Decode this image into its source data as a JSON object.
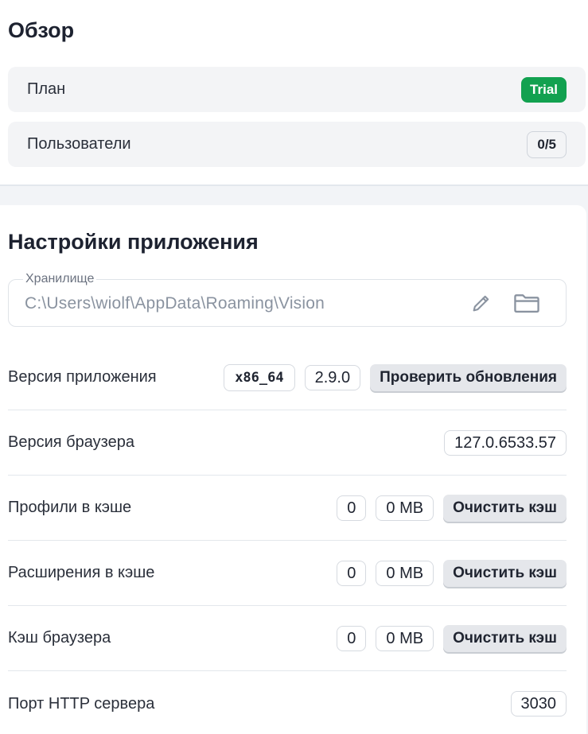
{
  "overview": {
    "title": "Обзор",
    "plan": {
      "label": "План",
      "badge": "Trial"
    },
    "users": {
      "label": "Пользователи",
      "badge": "0/5"
    }
  },
  "settings": {
    "title": "Настройки приложения",
    "storage": {
      "label": "Хранилище",
      "value": "C:\\Users\\wiolf\\AppData\\Roaming\\Vision",
      "icons": [
        "pencil-icon",
        "folder-icon"
      ]
    },
    "app_version": {
      "label": "Версия приложения",
      "arch": "x86_64",
      "version": "2.9.0",
      "button": "Проверить обновления"
    },
    "browser_version": {
      "label": "Версия браузера",
      "value": "127.0.6533.57"
    },
    "cached_profiles": {
      "label": "Профили в кэше",
      "count": "0",
      "size": "0 MB",
      "button": "Очистить кэш"
    },
    "cached_extensions": {
      "label": "Расширения в кэше",
      "count": "0",
      "size": "0 MB",
      "button": "Очистить кэш"
    },
    "browser_cache": {
      "label": "Кэш браузера",
      "count": "0",
      "size": "0 MB",
      "button": "Очистить кэш"
    },
    "http_port": {
      "label": "Порт HTTP сервера",
      "value": "3030"
    }
  },
  "colors": {
    "trial_badge": "#12a150",
    "button_bg": "#e5e7eb",
    "page_bg": "#f2f4f7"
  }
}
